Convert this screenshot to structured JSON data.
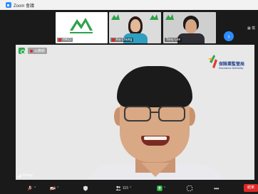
{
  "window": {
    "title": "Zoom 會議"
  },
  "gallery": {
    "tiles": [
      {
        "name": "HKCI"
      },
      {
        "name": "Ka Chung"
      },
      {
        "name": "Tony Lee"
      }
    ],
    "next_icon": "chevron-right-icon",
    "side_label": "檢"
  },
  "main_video": {
    "speaker_label": "以撒斯",
    "logo_cn": "保險業監管局",
    "logo_en": "Insurance Authority",
    "connection_label": "Zhang"
  },
  "toolbar": {
    "participants_count": "115",
    "end_label": "結束"
  },
  "colors": {
    "zoom_blue": "#2d8cff",
    "end_red": "#e02828",
    "toolbar_bg": "#1a1a1a",
    "ia_blue": "#1f3f8a"
  }
}
